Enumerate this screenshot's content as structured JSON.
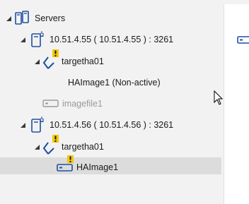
{
  "tree": {
    "root": {
      "label": "Servers",
      "icon": "servers-icon",
      "expanded": true
    },
    "nodes": [
      {
        "label": "10.51.4.55 ( 10.51.4.55 ) : 3261",
        "icon": "server-icon",
        "expanded": true,
        "targets": [
          {
            "label": "targetha01",
            "icon": "target-icon",
            "warning": "!",
            "expanded": true,
            "items": [
              {
                "label": "HAImage1 (Non-active)",
                "icon": "none"
              },
              {
                "label": "imagefile1",
                "icon": "image-file-icon",
                "state": "disabled"
              }
            ]
          }
        ]
      },
      {
        "label": "10.51.4.56 ( 10.51.4.56 ) : 3261",
        "icon": "server-icon",
        "expanded": true,
        "targets": [
          {
            "label": "targetha01",
            "icon": "target-icon",
            "warning": "!",
            "expanded": true,
            "items": [
              {
                "label": "HAImage1",
                "icon": "ha-image-icon",
                "warning": "!",
                "selected": true
              }
            ]
          }
        ]
      }
    ]
  },
  "colors": {
    "icon_blue": "#1f4fa0",
    "warning_yellow": "#f6c700",
    "selection": "#dcdcdc",
    "muted_text": "#9a9a9a"
  }
}
